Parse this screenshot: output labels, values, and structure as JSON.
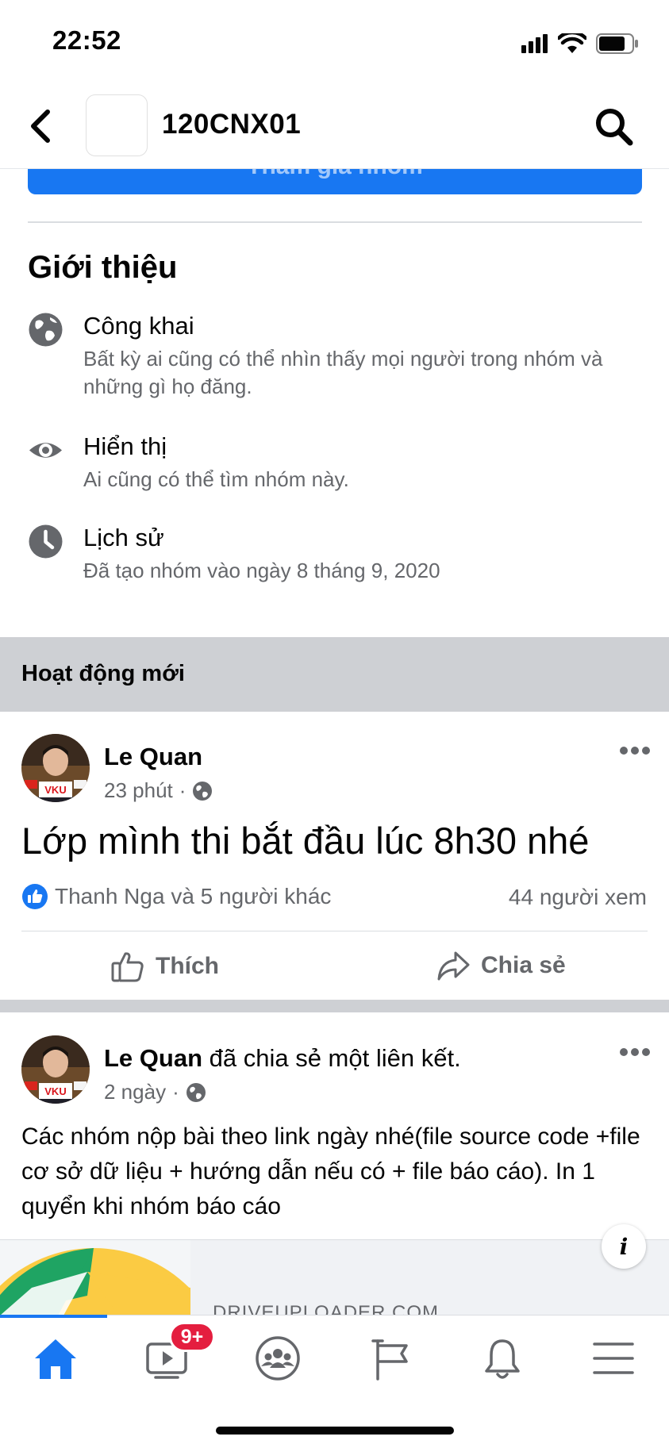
{
  "status_bar": {
    "time": "22:52"
  },
  "header": {
    "title": "120CNX01"
  },
  "join_button": {
    "label": "Tham gia nhóm"
  },
  "about": {
    "title": "Giới thiệu",
    "items": [
      {
        "icon": "globe-icon",
        "label": "Công khai",
        "description": "Bất kỳ ai cũng có thể nhìn thấy mọi người trong nhóm và những gì họ đăng."
      },
      {
        "icon": "eye-icon",
        "label": "Hiển thị",
        "description": "Ai cũng có thể tìm nhóm này."
      },
      {
        "icon": "clock-icon",
        "label": "Lịch sử",
        "description": "Đã tạo nhóm vào ngày 8 tháng 9, 2020"
      }
    ]
  },
  "activity": {
    "title": "Hoạt động mới"
  },
  "posts": [
    {
      "author": "Le Quan",
      "time": "23 phút",
      "text": "Lớp mình thi bắt đầu lúc 8h30 nhé",
      "reactions": "Thanh Nga và 5 người khác",
      "views": "44 người xem",
      "like_label": "Thích",
      "share_label": "Chia sẻ"
    },
    {
      "author": "Le Quan",
      "shared_text": " đã chia sẻ một liên kết.",
      "time": "2 ngày",
      "text": "Các nhóm nộp bài theo link ngày nhé(file source code +file cơ sở dữ liệu + hướng dẫn nếu có + file báo cáo). In 1 quyển khi nhóm báo cáo",
      "link_domain": "DRIVEUPLOADER.COM"
    }
  ],
  "avatar_logo_text": "VKU",
  "bottom_nav": {
    "watch_badge": "9+"
  },
  "colors": {
    "accent": "#1877f2",
    "badge": "#e41e3f",
    "secondary_text": "#65676b",
    "band": "#ced0d4"
  }
}
